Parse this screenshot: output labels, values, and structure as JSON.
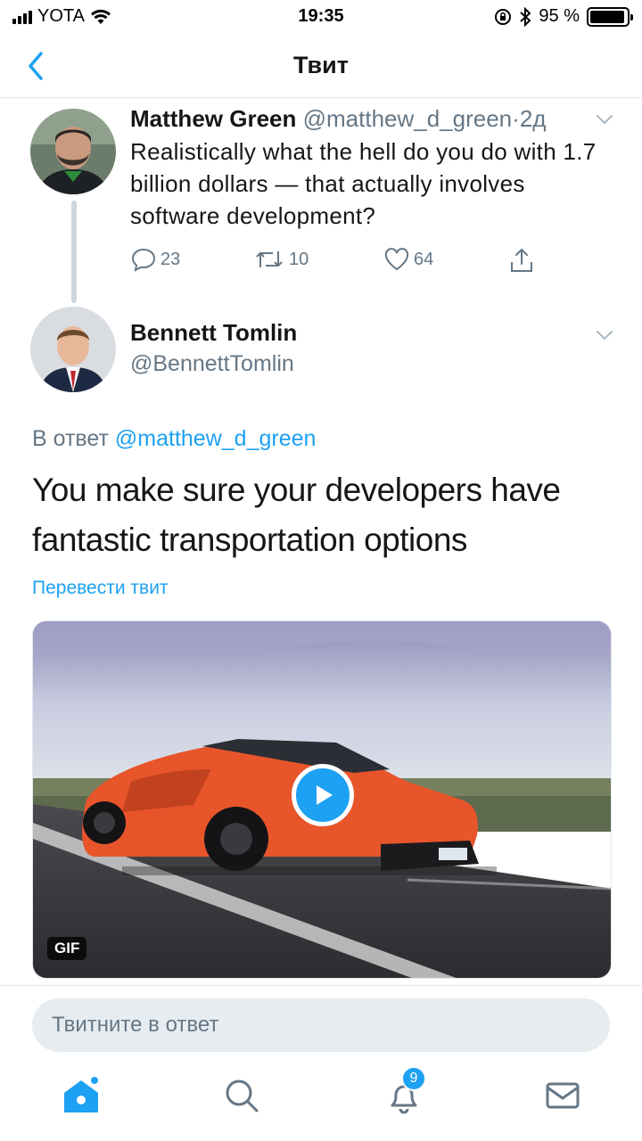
{
  "status_bar": {
    "carrier": "YOTA",
    "time": "19:35",
    "battery": "95 %",
    "battery_level": 0.95
  },
  "header": {
    "title": "Твит",
    "back_icon": "chevron-left-icon"
  },
  "parent_tweet": {
    "name": "Matthew Green",
    "handle": "@matthew_d_green",
    "separator": "·",
    "time": "2д",
    "text": "Realistically what the hell do you do with 1.7 billion dollars — that actually involves software development?",
    "replies": "23",
    "retweets": "10",
    "likes": "64"
  },
  "main_tweet": {
    "name": "Bennett Tomlin",
    "handle": "@BennettTomlin",
    "reply_prefix": "В ответ",
    "reply_mention": "@matthew_d_green",
    "text": "You make sure your developers have fantastic transportation options",
    "translate": "Перевести твит",
    "media_badge": "GIF"
  },
  "reply_box": {
    "placeholder": "Твитните в ответ"
  },
  "tabbar": {
    "notifications_count": "9"
  },
  "colors": {
    "accent": "#1da1f2",
    "secondary_text": "#657786",
    "primary_text": "#14171a"
  }
}
